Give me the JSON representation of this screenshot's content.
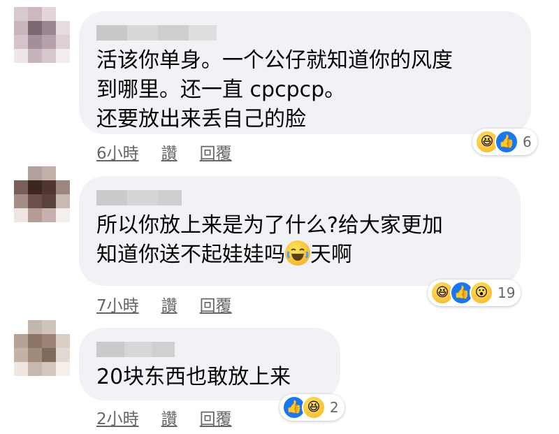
{
  "comments": [
    {
      "text": "活该你单身。一个公仔就知道你的风度\n到哪里。还一直 cpcpcp。\n还要放出来丢自己的脸",
      "time": "6小時",
      "like": "讚",
      "reply": "回覆",
      "reactions": [
        "haha-icon",
        "like-icon"
      ],
      "reaction_count": "6"
    },
    {
      "text_before": "所以你放上来是为了什么?给大家更加\n知道你送不起娃娃吗",
      "text_after": "天啊",
      "inline_emoji": "crying-laughing-emoji-icon",
      "time": "7小時",
      "like": "讚",
      "reply": "回覆",
      "reactions": [
        "haha-icon",
        "like-icon",
        "wow-icon"
      ],
      "reaction_count": "19"
    },
    {
      "text": "20块东西也敢放上来",
      "time": "2小時",
      "like": "讚",
      "reply": "回覆",
      "reactions": [
        "like-icon",
        "haha-icon"
      ],
      "reaction_count": "2"
    }
  ],
  "colors": {
    "bubble": "#f0f2f5",
    "meta_text": "#65676b",
    "like_blue": "#1877f2",
    "haha_yellow": "#f7b125"
  }
}
